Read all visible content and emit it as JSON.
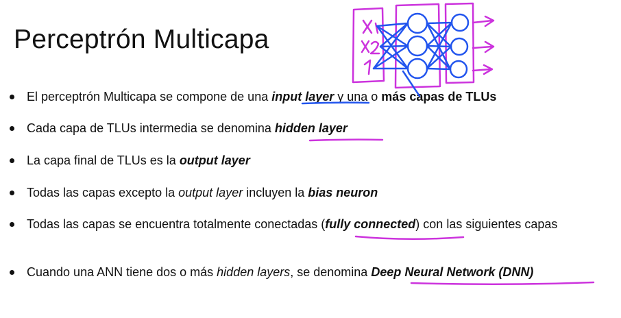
{
  "title": "Perceptrón Multicapa",
  "bullets": [
    {
      "parts": [
        {
          "text": "El perceptrón Multicapa se compone de una ",
          "style": "normal"
        },
        {
          "text": "input layer",
          "style": "bold-italic"
        },
        {
          "text": " y una o ",
          "style": "normal"
        },
        {
          "text": "más capas de TLUs",
          "style": "bold"
        }
      ]
    },
    {
      "parts": [
        {
          "text": "Cada capa de TLUs intermedia se denomina ",
          "style": "normal"
        },
        {
          "text": "hidden layer",
          "style": "bold-italic"
        }
      ]
    },
    {
      "parts": [
        {
          "text": "La capa final de TLUs es la ",
          "style": "normal"
        },
        {
          "text": "output layer",
          "style": "bold-italic"
        }
      ]
    },
    {
      "parts": [
        {
          "text": "Todas las capas excepto la ",
          "style": "normal"
        },
        {
          "text": "output layer",
          "style": "italic"
        },
        {
          "text": " incluyen la ",
          "style": "normal"
        },
        {
          "text": "bias neuron",
          "style": "bold-italic"
        }
      ]
    },
    {
      "parts": [
        {
          "text": "Todas las capas se encuentra totalmente conectadas (",
          "style": "normal"
        },
        {
          "text": "fully connected",
          "style": "bold-italic"
        },
        {
          "text": ") con las siguientes capas",
          "style": "normal"
        }
      ]
    },
    {
      "parts": [
        {
          "text": "Cuando una ANN tiene dos o más ",
          "style": "normal"
        },
        {
          "text": "hidden layers",
          "style": "italic"
        },
        {
          "text": ", se denomina ",
          "style": "normal"
        },
        {
          "text": "Deep Neural Network (DNN)",
          "style": "bold-italic"
        }
      ]
    }
  ],
  "sketch": {
    "inputs": [
      "X1",
      "X2",
      "1"
    ],
    "colors": {
      "magenta": "#cc33dd",
      "blue": "#2255ee"
    }
  }
}
